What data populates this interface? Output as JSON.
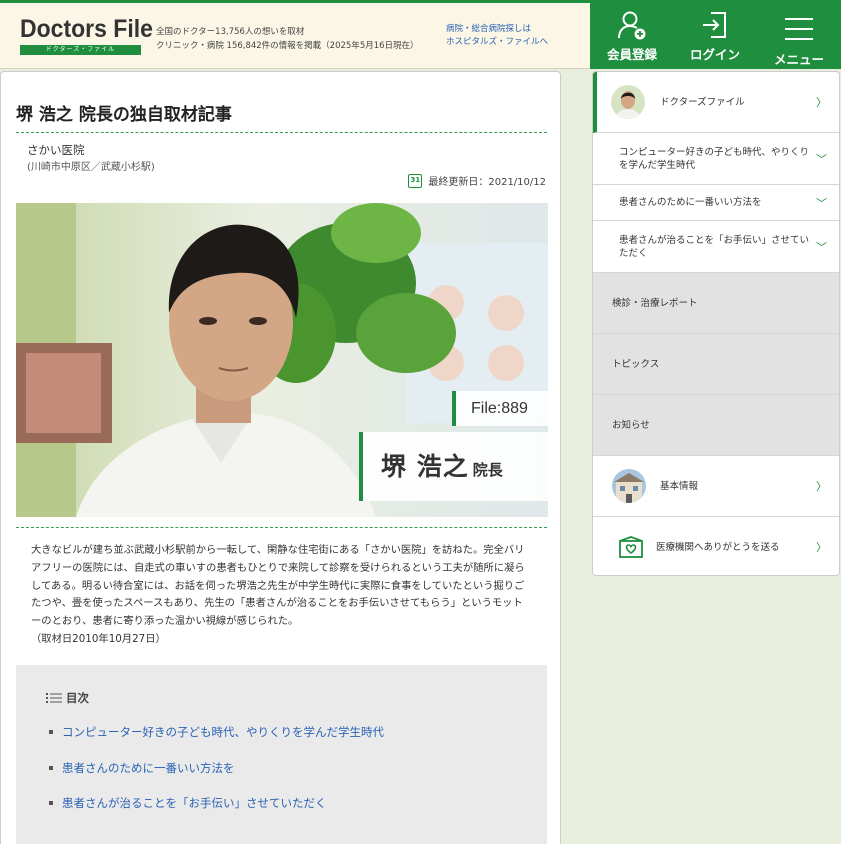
{
  "header": {
    "logo_main": "Doctors File",
    "logo_sub": "ドクターズ・ファイル",
    "stats_line1": "全国のドクター13,756人の想いを取材",
    "stats_line2": "クリニック・病院 156,842件の情報を掲載（2025年5月16日現在）",
    "hospital_link_line1": "病院・総合病院探しは",
    "hospital_link_line2": "ホスピタルズ・ファイルへ",
    "nav": {
      "register": "会員登録",
      "login": "ログイン",
      "menu": "メニュー"
    }
  },
  "article": {
    "title": "堺 浩之 院長の独自取材記事",
    "clinic_name": "さかい医院",
    "location": "(川崎市中原区／武蔵小杉駅)",
    "calendar_day": "31",
    "updated": "最終更新日：2021/10/12",
    "file_no": "File:889",
    "doctor_name": "堺 浩之",
    "doctor_role": "院長",
    "intro": "大きなビルが建ち並ぶ武蔵小杉駅前から一転して、閑静な住宅街にある「さかい医院」を訪ねた。完全バリアフリーの医院には、自走式の車いすの患者もひとりで来院して診察を受けられるという工夫が随所に凝らしてある。明るい待合室には、お話を伺った堺浩之先生が中学生時代に実際に食事をしていたという掘りごたつや、畳を使ったスペースもあり、先生の「患者さんが治ることをお手伝いさせてもらう」というモットーのとおり、患者に寄り添った温かい視線が感じられた。",
    "interview_date": "（取材日2010年10月27日）"
  },
  "toc": {
    "heading": "目次",
    "items": [
      "コンピューター好きの子ども時代、やりくりを学んだ学生時代",
      "患者さんのために一番いい方法を",
      "患者さんが治ることを「お手伝い」させていただく"
    ]
  },
  "sidebar": {
    "doctors_file": "ドクターズファイル",
    "sub_items": [
      "コンピューター好きの子ども時代、やりくりを学んだ学生時代",
      "患者さんのために一番いい方法を",
      "患者さんが治ることを「お手伝い」させていただく"
    ],
    "report": "検診・治療レポート",
    "topics": "トピックス",
    "news": "お知らせ",
    "basic_info": "基本情報",
    "thanks": "医療機関へありがとうを送る"
  },
  "colors": {
    "brand_green": "#1f8f3f",
    "link_blue": "#2a62b4",
    "header_bg": "#fbf6e6",
    "page_bg": "#e8eedd"
  },
  "icons": [
    "user-plus-icon",
    "login-icon",
    "menu-icon",
    "calendar-icon",
    "list-icon",
    "chevron-right-icon",
    "chevron-down-icon",
    "heart-mail-icon"
  ]
}
